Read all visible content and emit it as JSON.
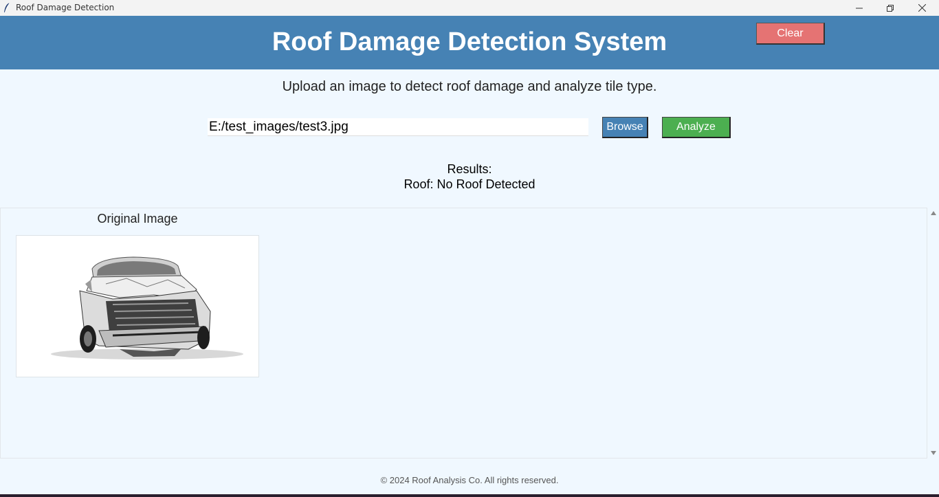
{
  "window": {
    "title": "Roof Damage Detection",
    "icons": {
      "app": "feather-icon",
      "minimize": "minimize-icon",
      "restore": "restore-icon",
      "close": "close-icon"
    }
  },
  "header": {
    "title": "Roof Damage Detection System",
    "clear_label": "Clear",
    "color": "#4682b4"
  },
  "subtitle": "Upload an image to detect roof damage and analyze tile type.",
  "upload": {
    "path_value": "E:/test_images/test3.jpg",
    "browse_label": "Browse",
    "analyze_label": "Analyze"
  },
  "results": {
    "heading": "Results:",
    "roof": "Roof: No Roof Detected"
  },
  "images": {
    "original_label": "Original Image"
  },
  "footer": "© 2024 Roof Analysis Co. All rights reserved.",
  "colors": {
    "background": "#f0f8ff",
    "clear_button": "#e57373",
    "browse_button": "#4682b4",
    "analyze_button": "#4caf50"
  }
}
